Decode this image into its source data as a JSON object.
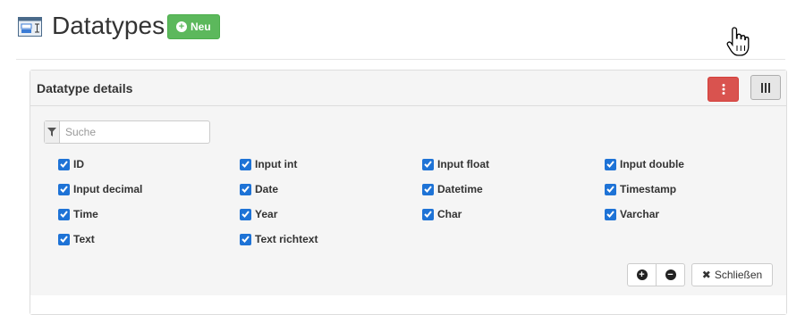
{
  "page": {
    "title": "Datatypes",
    "new_button_label": "Neu",
    "page_icon": "table-window-icon",
    "new_icon": "plus-circle-icon"
  },
  "panel": {
    "title": "Datatype details",
    "menu_icon": "vertical-ellipsis-icon",
    "columns_icon": "columns-icon",
    "colors": {
      "danger": "#d9534f",
      "success": "#5cb85c",
      "checkbox": "#1e73d6"
    }
  },
  "column_chooser": {
    "search": {
      "placeholder": "Suche",
      "value": "",
      "icon": "filter-icon"
    },
    "columns": [
      {
        "label": "ID",
        "checked": true
      },
      {
        "label": "Input int",
        "checked": true
      },
      {
        "label": "Input float",
        "checked": true
      },
      {
        "label": "Input double",
        "checked": true
      },
      {
        "label": "Input decimal",
        "checked": true
      },
      {
        "label": "Date",
        "checked": true
      },
      {
        "label": "Datetime",
        "checked": true
      },
      {
        "label": "Timestamp",
        "checked": true
      },
      {
        "label": "Time",
        "checked": true
      },
      {
        "label": "Year",
        "checked": true
      },
      {
        "label": "Char",
        "checked": true
      },
      {
        "label": "Varchar",
        "checked": true
      },
      {
        "label": "Text",
        "checked": true
      },
      {
        "label": "Text richtext",
        "checked": true
      }
    ],
    "select_all_icon": "plus-circle-icon",
    "deselect_all_icon": "minus-circle-icon",
    "close_label": "Schließen",
    "close_icon": "close-icon"
  }
}
